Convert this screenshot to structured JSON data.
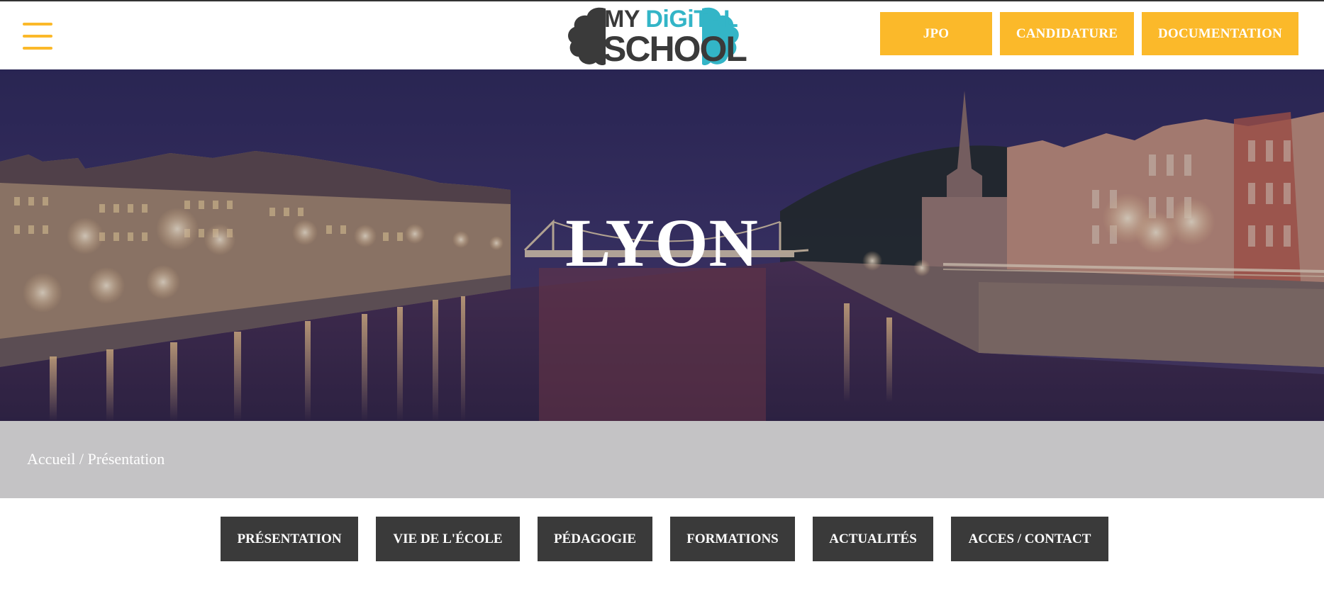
{
  "header": {
    "menu_icon": "hamburger-menu-icon",
    "logo": {
      "line1_a": "MY",
      "line1_b": "DiGiTAL",
      "line2": "SCHOOL",
      "colors": {
        "dark": "#3a3a3a",
        "cyan": "#33b5c7"
      }
    },
    "buttons": {
      "jpo": "JPO",
      "candidature": "CANDIDATURE",
      "documentation": "DOCUMENTATION"
    }
  },
  "hero": {
    "title": "LYON"
  },
  "breadcrumb": {
    "home": "Accueil",
    "separator": " / ",
    "current": "Présentation"
  },
  "subnav": {
    "items": [
      "PRÉSENTATION",
      "VIE DE L'ÉCOLE",
      "PÉDAGOGIE",
      "FORMATIONS",
      "ACTUALITÉS",
      "ACCES / CONTACT"
    ]
  },
  "colors": {
    "accent": "#fbb92a",
    "dark_button": "#3a3a3a",
    "breadcrumb_bg": "#c4c3c5"
  }
}
